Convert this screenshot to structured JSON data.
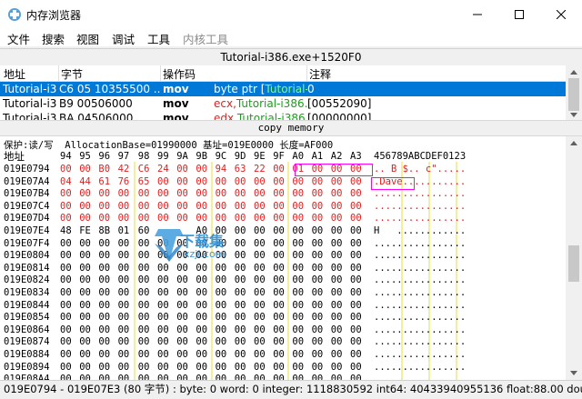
{
  "window": {
    "title": "内存浏览器"
  },
  "menu": [
    "文件",
    "搜索",
    "视图",
    "调试",
    "工具",
    "内核工具"
  ],
  "address_bar": "Tutorial-i386.exe+1520F0",
  "disasm": {
    "headers": [
      "地址",
      "字节",
      "操作码",
      "注释"
    ],
    "rows": [
      {
        "addr": "Tutorial-i3",
        "bytes": "C6 05 10355500 ...",
        "op": "mov",
        "args": "byte ptr [",
        "args_green": "Tutorial-",
        "comment": "0",
        "selected": true
      },
      {
        "addr": "Tutorial-i3",
        "bytes": "B9 00506000",
        "op": "mov",
        "args": "ecx,",
        "args_green": "Tutorial-i386.e",
        "comment": "[00552090]",
        "selected": false
      },
      {
        "addr": "Tutorial-i3",
        "bytes": "BA 04506000",
        "op": "mov",
        "args": "edx,",
        "args_green": "Tutorial-i386",
        "comment": "[00000000]",
        "selected": false
      }
    ]
  },
  "copy_memory_label": "copy memory",
  "hex": {
    "info": "保护:读/写  AllocationBase=01990000 基址=019E0000 长度=AF000",
    "header_addr": "地址",
    "header_cols": [
      "94",
      "95",
      "96",
      "97",
      "98",
      "99",
      "9A",
      "9B",
      "9C",
      "9D",
      "9E",
      "9F",
      "A0",
      "A1",
      "A2",
      "A3"
    ],
    "header_ascii": "456789ABCDEF0123",
    "rows": [
      {
        "addr": "019E0794",
        "bytes": [
          "00",
          "00",
          "B0",
          "42",
          "C6",
          "24",
          "00",
          "00",
          "94",
          "63",
          "22",
          "00",
          "01",
          "00",
          "00",
          "00"
        ],
        "ascii": ".. B $.. c\"....."
      },
      {
        "addr": "019E07A4",
        "bytes": [
          "04",
          "44",
          "61",
          "76",
          "65",
          "00",
          "00",
          "00",
          "00",
          "00",
          "00",
          "00",
          "00",
          "00",
          "00",
          "00"
        ],
        "ascii": ".Dave..........."
      },
      {
        "addr": "019E07B4",
        "bytes": [
          "00",
          "00",
          "00",
          "00",
          "00",
          "00",
          "00",
          "00",
          "00",
          "00",
          "00",
          "00",
          "00",
          "00",
          "00",
          "00"
        ],
        "ascii": "................"
      },
      {
        "addr": "019E07C4",
        "bytes": [
          "00",
          "00",
          "00",
          "00",
          "00",
          "00",
          "00",
          "00",
          "00",
          "00",
          "00",
          "00",
          "00",
          "00",
          "00",
          "00"
        ],
        "ascii": "................"
      },
      {
        "addr": "019E07D4",
        "bytes": [
          "00",
          "00",
          "00",
          "00",
          "00",
          "00",
          "00",
          "00",
          "00",
          "00",
          "00",
          "00",
          "00",
          "00",
          "00",
          "00"
        ],
        "ascii": "................"
      },
      {
        "addr": "019E07E4",
        "bytes": [
          "48",
          "FE",
          "8B",
          "01",
          "60",
          "",
          "",
          "A0",
          "00",
          "00",
          "00",
          "00",
          "00",
          "00",
          "00",
          "00"
        ],
        "ascii": "H   ............"
      },
      {
        "addr": "019E07F4",
        "bytes": [
          "00",
          "00",
          "00",
          "00",
          "00",
          "00",
          "00",
          "00",
          "00",
          "00",
          "00",
          "00",
          "00",
          "00",
          "00",
          "00"
        ],
        "ascii": "................"
      },
      {
        "addr": "019E0804",
        "bytes": [
          "00",
          "00",
          "00",
          "00",
          "00",
          "00",
          "00",
          "00",
          "00",
          "00",
          "00",
          "00",
          "00",
          "00",
          "00",
          "00"
        ],
        "ascii": "................"
      },
      {
        "addr": "019E0814",
        "bytes": [
          "00",
          "00",
          "00",
          "00",
          "00",
          "00",
          "00",
          "00",
          "00",
          "00",
          "00",
          "00",
          "00",
          "00",
          "00",
          "00"
        ],
        "ascii": "................"
      },
      {
        "addr": "019E0824",
        "bytes": [
          "00",
          "00",
          "00",
          "00",
          "00",
          "00",
          "00",
          "00",
          "00",
          "00",
          "00",
          "00",
          "00",
          "00",
          "00",
          "00"
        ],
        "ascii": "................"
      },
      {
        "addr": "019E0834",
        "bytes": [
          "00",
          "00",
          "00",
          "00",
          "00",
          "00",
          "00",
          "00",
          "00",
          "00",
          "00",
          "00",
          "00",
          "00",
          "00",
          "00"
        ],
        "ascii": "................"
      },
      {
        "addr": "019E0844",
        "bytes": [
          "00",
          "00",
          "00",
          "00",
          "00",
          "00",
          "00",
          "00",
          "00",
          "00",
          "00",
          "00",
          "00",
          "00",
          "00",
          "00"
        ],
        "ascii": "................"
      },
      {
        "addr": "019E0854",
        "bytes": [
          "00",
          "00",
          "00",
          "00",
          "00",
          "00",
          "00",
          "00",
          "00",
          "00",
          "00",
          "00",
          "00",
          "00",
          "00",
          "00"
        ],
        "ascii": "................"
      },
      {
        "addr": "019E0864",
        "bytes": [
          "00",
          "00",
          "00",
          "00",
          "00",
          "00",
          "00",
          "00",
          "00",
          "00",
          "00",
          "00",
          "00",
          "00",
          "00",
          "00"
        ],
        "ascii": "................"
      },
      {
        "addr": "019E0874",
        "bytes": [
          "00",
          "00",
          "00",
          "00",
          "00",
          "00",
          "00",
          "00",
          "00",
          "00",
          "00",
          "00",
          "00",
          "00",
          "00",
          "00"
        ],
        "ascii": "................"
      },
      {
        "addr": "019E0884",
        "bytes": [
          "00",
          "00",
          "00",
          "00",
          "00",
          "00",
          "00",
          "00",
          "00",
          "00",
          "00",
          "00",
          "00",
          "00",
          "00",
          "00"
        ],
        "ascii": "................"
      },
      {
        "addr": "019E0894",
        "bytes": [
          "00",
          "00",
          "00",
          "00",
          "00",
          "00",
          "00",
          "00",
          "00",
          "00",
          "00",
          "00",
          "00",
          "00",
          "00",
          "00"
        ],
        "ascii": "................"
      },
      {
        "addr": "019E08A4",
        "bytes": [
          "00",
          "00",
          "00",
          "00",
          "00",
          "00",
          "00",
          "00",
          "00",
          "00",
          "00",
          "00",
          "00",
          "00",
          "00",
          "00"
        ],
        "ascii": "................"
      }
    ]
  },
  "status": "019E0794 - 019E07E3 (80 字节) : byte: 0 word: 0 integer: 1118830592 int64: 40433940955136 float:88.00 doub",
  "watermark_text": "下载集",
  "watermark_sub": "xzji.com",
  "colors": {
    "selection": "#0078d7",
    "changed_bytes": "#e02020",
    "symbol": "#1a9e1a",
    "highlight_box": "#ff00ff",
    "separator": "#f3ef9a"
  }
}
